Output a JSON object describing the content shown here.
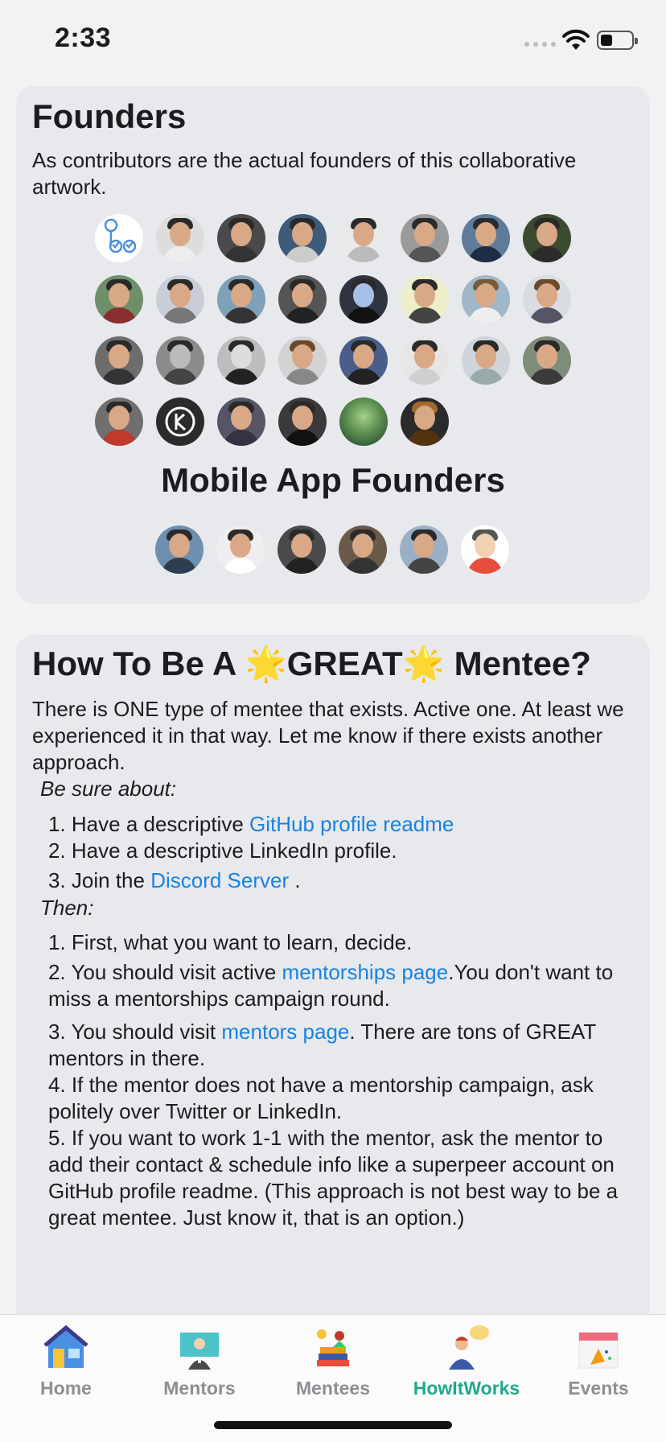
{
  "status_bar": {
    "time": "2:33"
  },
  "founders": {
    "title": "Founders",
    "description": "As contributors are the actual founders of this collaborative artwork.",
    "mobile_title": "Mobile App Founders"
  },
  "mentee": {
    "title_pre": "How To Be A ",
    "title_star": "🌟",
    "title_mid": "GREAT",
    "title_post": " Mentee?",
    "intro": "There is ONE type of mentee that exists. Active one. At least we experienced it in that way. Let me know if there exists another approach.",
    "be_sure_label": "Be sure about:",
    "be_sure_items": {
      "i1_text": "1. Have a descriptive ",
      "i1_link": "GitHub profile readme",
      "i2_text": "2. Have a descriptive LinkedIn profile.",
      "i3_text": "3. Join the ",
      "i3_link": "Discord Server",
      "i3_end": " ."
    },
    "then_label": "Then:",
    "then_items": {
      "t1": "1. First, what you want to learn, decide.",
      "t2_text": "2. You should visit active ",
      "t2_link": "mentorships page",
      "t2_end": ".You don't want to miss a mentorships campaign round.",
      "t3_text": "3. You should visit ",
      "t3_link": "mentors page",
      "t3_end": ". There are tons of GREAT mentors in there.",
      "t4": "4. If the mentor does not have a mentorship campaign, ask politely over Twitter or LinkedIn.",
      "t5": "5. If you want to work 1-1 with the mentor, ask the mentor to add their contact & schedule info like a superpeer account on GitHub profile readme. (This approach is not best way to be a great mentee. Just know it, that is an option.)"
    }
  },
  "tabs": {
    "home": "Home",
    "mentors": "Mentors",
    "mentees": "Mentees",
    "howitworks": "HowItWorks",
    "events": "Events",
    "active": "howitworks"
  },
  "colors": {
    "link": "#1a82e2",
    "active_tab": "#20a98b",
    "card_bg": "#e7e9ec"
  }
}
